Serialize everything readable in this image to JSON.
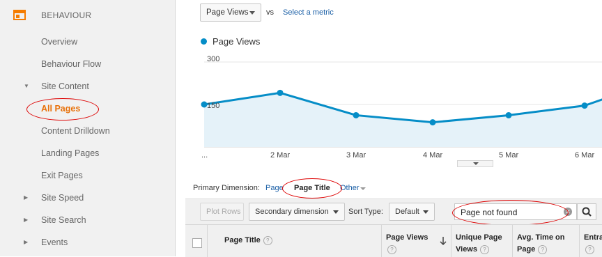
{
  "sidebar": {
    "section_title": "BEHAVIOUR",
    "items": [
      {
        "label": "Overview"
      },
      {
        "label": "Behaviour Flow"
      },
      {
        "label": "Site Content",
        "arrow": "▼"
      },
      {
        "label": "All Pages"
      },
      {
        "label": "Content Drilldown"
      },
      {
        "label": "Landing Pages"
      },
      {
        "label": "Exit Pages"
      },
      {
        "label": "Site Speed",
        "arrow": "▶"
      },
      {
        "label": "Site Search",
        "arrow": "▶"
      },
      {
        "label": "Events",
        "arrow": "▶"
      }
    ],
    "accent": "#f57c00"
  },
  "explorer": {
    "metric_select": "Page Views",
    "vs_label": "vs",
    "select_metric_link": "Select a metric",
    "legend": "Page Views"
  },
  "chart_data": {
    "type": "area",
    "series": [
      {
        "name": "Page Views",
        "values": [
          150,
          191,
          112,
          87,
          112,
          146,
          170
        ]
      }
    ],
    "x_labels": [
      "...",
      "2 Mar",
      "3 Mar",
      "4 Mar",
      "5 Mar",
      "6 Mar"
    ],
    "y_ticks": [
      "300",
      "150"
    ],
    "ylim": [
      0,
      300
    ],
    "color": "#058dc7"
  },
  "dimension": {
    "label": "Primary Dimension:",
    "page": "Page",
    "page_title": "Page Title",
    "other": "Other"
  },
  "toolbar": {
    "plot_rows": "Plot Rows",
    "secondary": "Secondary dimension",
    "sort_type_label": "Sort Type:",
    "sort_default": "Default",
    "search_value": "Page not found",
    "clear_glyph": "✕"
  },
  "table": {
    "headers": [
      {
        "l1": "Page Title",
        "l2": ""
      },
      {
        "l1": "Page Views",
        "l2": ""
      },
      {
        "l1": "Unique Page",
        "l2": "Views"
      },
      {
        "l1": "Avg. Time on",
        "l2": "Page"
      },
      {
        "l1": "Entra",
        "l2": ""
      }
    ],
    "help_glyph": "?"
  }
}
